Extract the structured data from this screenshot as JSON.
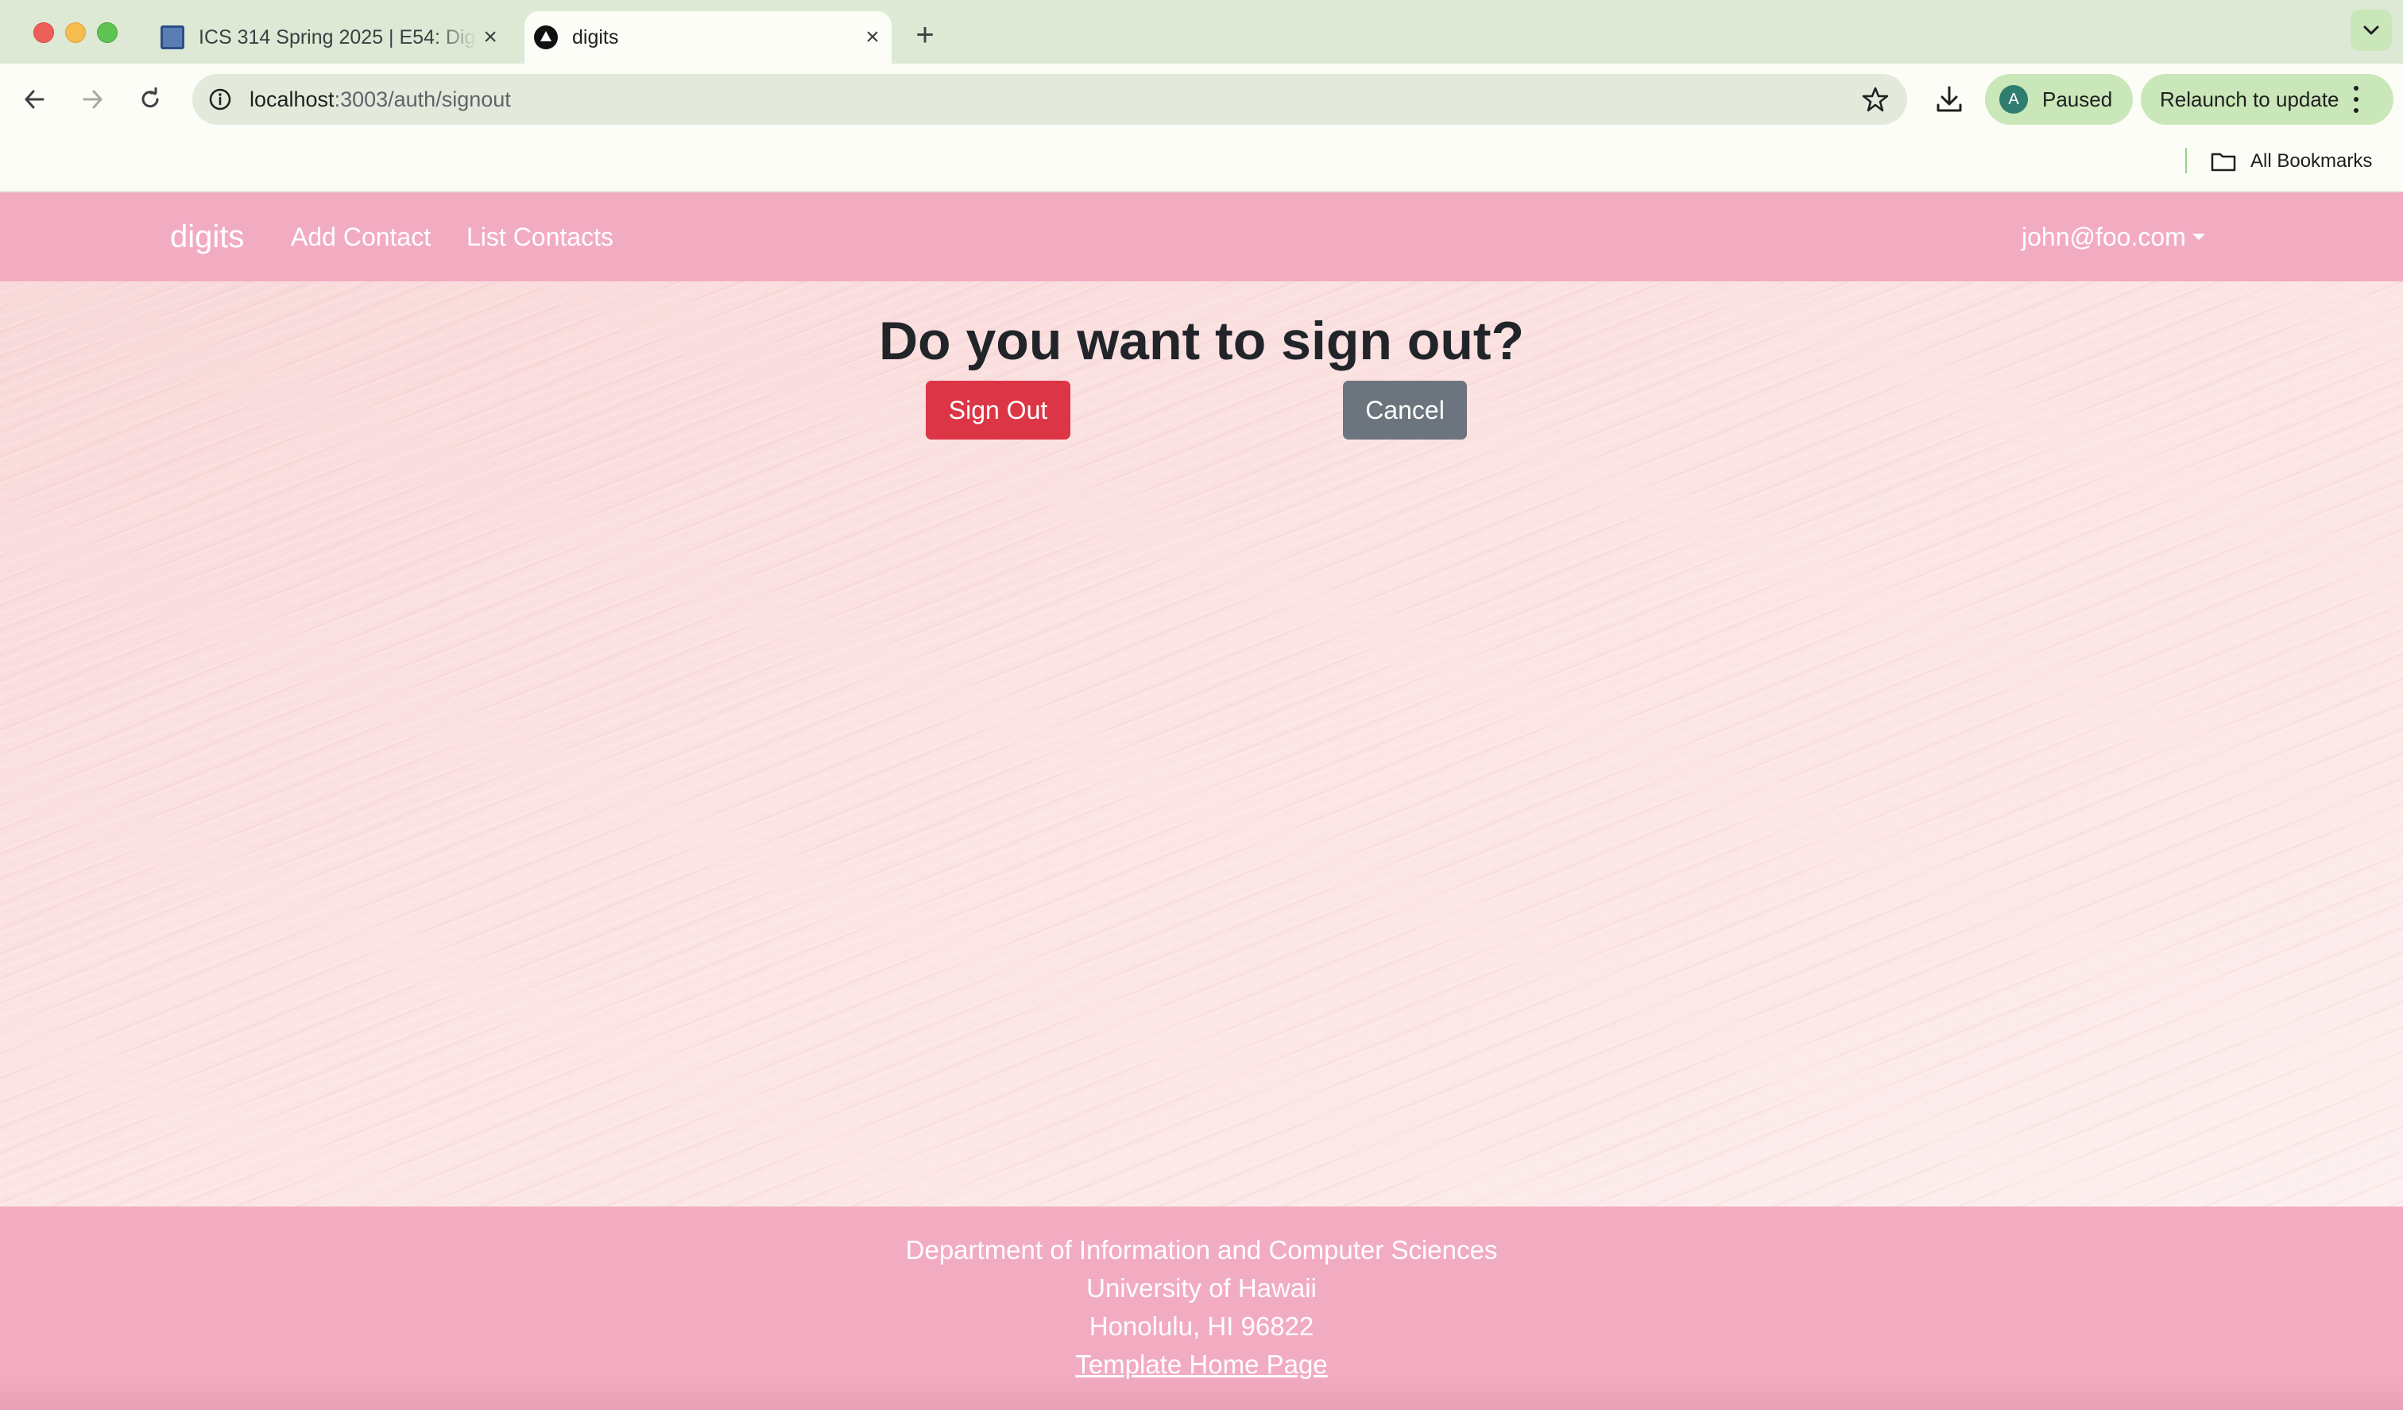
{
  "browser": {
    "tabs": [
      {
        "title": "ICS 314 Spring 2025 | E54: Digits",
        "active": false
      },
      {
        "title": "digits",
        "active": true
      }
    ],
    "new_tab_label": "+",
    "url_host": "localhost",
    "url_path": ":3003/auth/signout",
    "profile": {
      "initial": "A",
      "status": "Paused"
    },
    "relaunch_label": "Relaunch to update",
    "bookmarks_label": "All Bookmarks",
    "accent_color": "#c9e7b8"
  },
  "site": {
    "brand": "digits",
    "nav": {
      "add_contact": "Add Contact",
      "list_contacts": "List Contacts"
    },
    "user_menu": "john@foo.com",
    "nav_color": "#f2acc2"
  },
  "signout": {
    "title": "Do you want to sign out?",
    "signout_button": "Sign Out",
    "cancel_button": "Cancel",
    "danger_color": "#dc3545",
    "secondary_color": "#6c757d"
  },
  "footer": {
    "line1": "Department of Information and Computer Sciences",
    "line2": "University of Hawaii",
    "line3": "Honolulu, HI 96822",
    "link": "Template Home Page"
  }
}
